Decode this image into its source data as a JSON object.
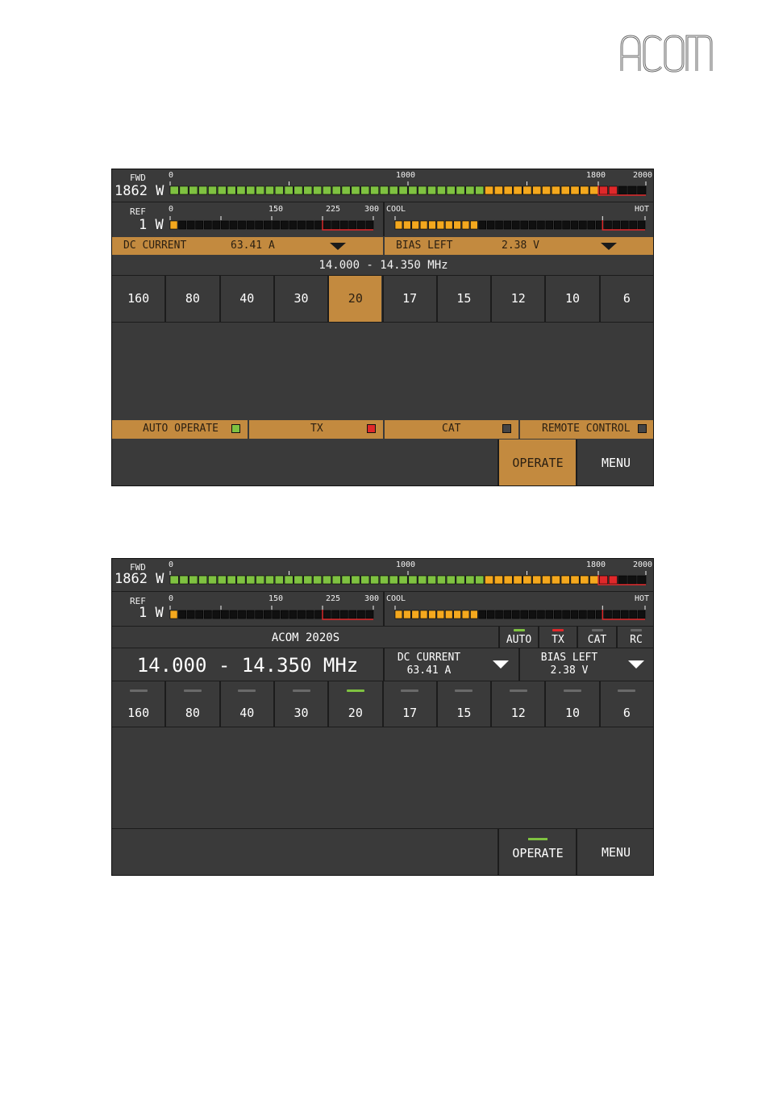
{
  "brand": {
    "logo_text": "ACOM"
  },
  "colors": {
    "accent": "#c38a3f",
    "panel": "#3a3a3a",
    "led_green": "#7fc241",
    "led_red": "#e0282a",
    "led_off": "#444444",
    "seg_green": "#7fc241",
    "seg_orange": "#f4a81e",
    "seg_red": "#e0282a",
    "seg_off": "#101010"
  },
  "meters": {
    "fwd": {
      "label": "FWD",
      "value_text": "1862 W",
      "scale": [
        "0",
        "1000",
        "1800",
        "2000"
      ],
      "value": 1862,
      "max": 2000
    },
    "ref": {
      "label": "REF",
      "value_text": "1 W",
      "scale": [
        "0",
        "150",
        "225",
        "300"
      ],
      "value": 1,
      "max": 300
    },
    "temp": {
      "scale_left": "COOL",
      "scale_right": "HOT",
      "level": 0.32
    }
  },
  "screen1": {
    "combo_left": {
      "label": "DC CURRENT",
      "value": "63.41 A"
    },
    "combo_right": {
      "label": "BIAS LEFT",
      "value": "2.38 V"
    },
    "frequency": "14.000 - 14.350 MHz",
    "bands": [
      "160",
      "80",
      "40",
      "30",
      "20",
      "17",
      "15",
      "12",
      "10",
      "6"
    ],
    "selected_band": "20",
    "status": [
      {
        "label": "AUTO OPERATE",
        "led": "green"
      },
      {
        "label": "TX",
        "led": "red"
      },
      {
        "label": "CAT",
        "led": "off"
      },
      {
        "label": "REMOTE CONTROL",
        "led": "off"
      }
    ],
    "operate_label": "OPERATE",
    "menu_label": "MENU"
  },
  "screen2": {
    "title": "ACOM 2020S",
    "indicators": [
      {
        "label": "AUTO",
        "state": "green"
      },
      {
        "label": "TX",
        "state": "red"
      },
      {
        "label": "CAT",
        "state": "off"
      },
      {
        "label": "RC",
        "state": "off"
      }
    ],
    "frequency": "14.000 - 14.350 MHz",
    "combo_left": {
      "label": "DC CURRENT",
      "value": "63.41 A"
    },
    "combo_right": {
      "label": "BIAS LEFT",
      "value": "2.38 V"
    },
    "bands": [
      "160",
      "80",
      "40",
      "30",
      "20",
      "17",
      "15",
      "12",
      "10",
      "6"
    ],
    "selected_band": "20",
    "operate_label": "OPERATE",
    "menu_label": "MENU"
  }
}
